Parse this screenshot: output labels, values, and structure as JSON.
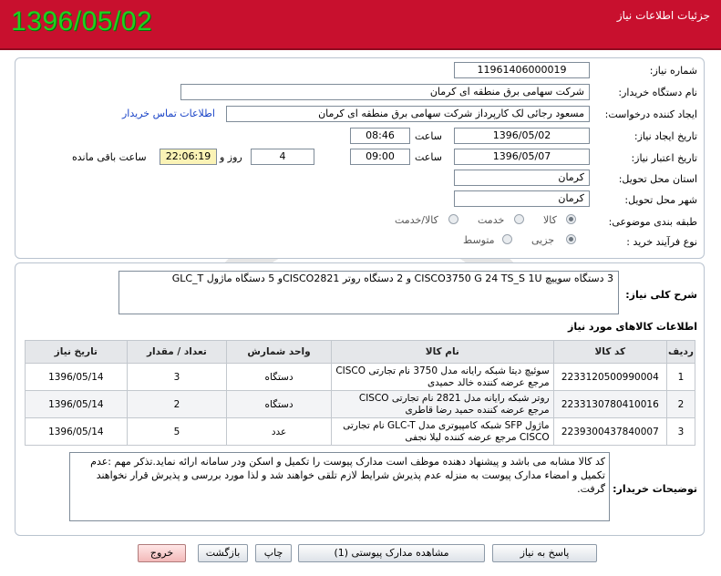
{
  "header": {
    "title": "جزئیات اطلاعات نیاز",
    "date": "1396/05/02"
  },
  "form": {
    "need_number_label": "شماره نیاز:",
    "need_number": "1196140600001‎9",
    "buyer_org_label": "نام دستگاه خریدار:",
    "buyer_org": "شرکت سهامی برق منطقه ای کرمان",
    "requester_label": "ایجاد کننده درخواست:",
    "requester": "مسعود رجائی لک کارپرداز شرکت سهامی برق منطقه ای کرمان",
    "contact_link": "اطلاعات تماس خریدار",
    "created_label": "تاریخ ایجاد نیاز:",
    "created_date": "1396/05/02",
    "time_label": "ساعت",
    "created_time": "08:46",
    "validity_label": "تاریخ اعتبار نیاز:",
    "validity_date": "1396/05/07",
    "validity_time": "09:00",
    "days_value": "4",
    "days_label": "روز و",
    "remaining_time": "22:06:19",
    "remaining_label": "ساعت باقی مانده",
    "province_label": "استان محل تحویل:",
    "province": "کرمان",
    "city_label": "شهر محل تحویل:",
    "city": "کرمان",
    "category_label": "طبقه بندی موضوعی:",
    "category_options": [
      "کالا",
      "خدمت",
      "کالا/خدمت"
    ],
    "purchase_type_label": "نوع فرآیند خرید :",
    "purchase_options": [
      "جزیی",
      "متوسط"
    ]
  },
  "summary": {
    "label": "شرح کلی نیاز:",
    "text": "3 دستگاه سوییچ CISCO3750 G 24 TS_S 1U و 2 دستگاه روتر CISCO2821و 5 دستگاه ماژول GLC_T"
  },
  "items_section": {
    "title": "اطلاعات کالاهای مورد نیاز",
    "columns": [
      "ردیف",
      "کد کالا",
      "نام کالا",
      "واحد شمارش",
      "تعداد / مقدار",
      "تاریخ نیاز"
    ],
    "rows": [
      {
        "row": "1",
        "code": "2233120500990004",
        "name": "سوئیچ دیتا شبکه رایانه مدل 3750 نام تجارتی CISCO مرجع عرضه کننده خالد حمیدی",
        "unit": "دستگاه",
        "qty": "3",
        "date": "1396/05/14"
      },
      {
        "row": "2",
        "code": "2233130780410016",
        "name": "روتر شبکه رایانه مدل 2821 نام تجارتی CISCO مرجع عرضه کننده حمید رضا قاطری",
        "unit": "دستگاه",
        "qty": "2",
        "date": "1396/05/14"
      },
      {
        "row": "3",
        "code": "2239300437840007",
        "name": "ماژول SFP شبکه کامپیوتری مدل GLC-T نام تجارتی CISCO مرجع عرضه کننده لیلا نجفی",
        "unit": "عدد",
        "qty": "5",
        "date": "1396/05/14"
      }
    ]
  },
  "notes": {
    "label": "توضیحات خریدار:",
    "text": "کد کالا مشابه می باشد و پیشنهاد دهنده موظف است مدارک پیوست را تکمیل و اسکن ودر سامانه ارائه نماید.تذکر مهم :عدم تکمیل و امضاء مدارک پیوست به منزله عدم پذیرش شرایط لازم تلقی خواهند شد و لذا مورد بررسی و پذیرش قرار نخواهند گرفت."
  },
  "buttons": {
    "reply": "پاسخ به نیاز",
    "attachments": "مشاهده مدارک پیوستی (1)",
    "print": "چاپ",
    "back": "بازگشت",
    "exit": "خروج"
  },
  "colors": {
    "header_bg": "#c8102e",
    "date_green": "#1fd21f",
    "link_blue": "#1a44c7",
    "remaining_yellow": "#fbf3b6"
  }
}
